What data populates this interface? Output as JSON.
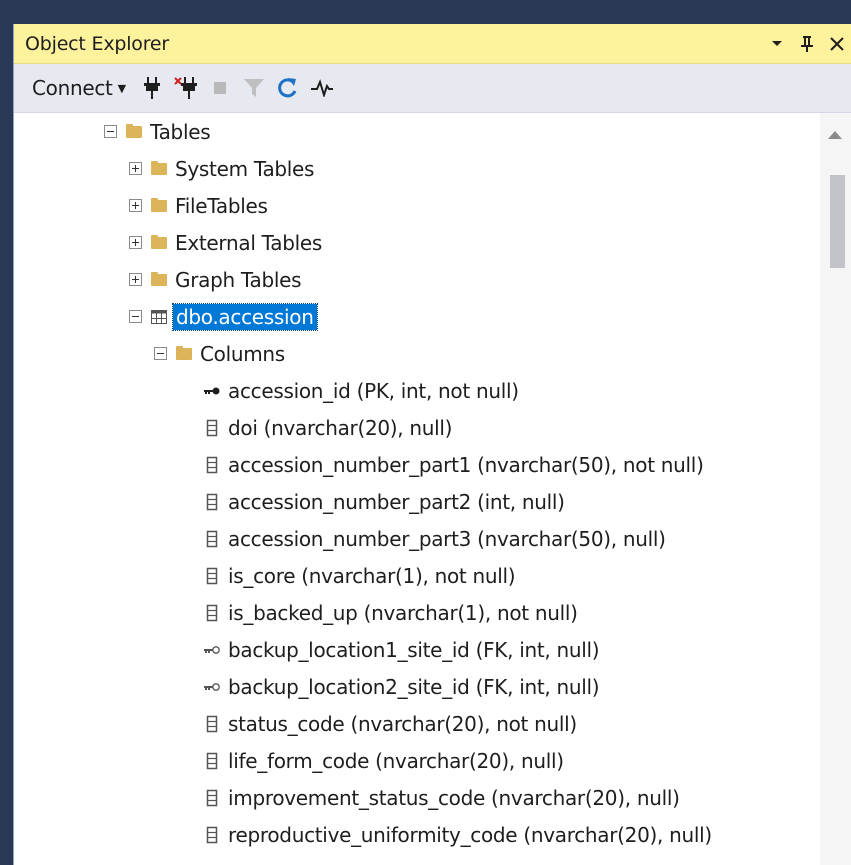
{
  "window": {
    "title": "Object Explorer",
    "controls": {
      "dropdown": "▾",
      "pin": "ᛜ",
      "close": "✕"
    }
  },
  "toolbar": {
    "connect_label": "Connect",
    "tools": [
      "connect-icon",
      "disconnect-icon",
      "stop-icon",
      "filter-icon",
      "refresh-icon",
      "activity-monitor-icon"
    ]
  },
  "tree": {
    "tables": {
      "label": "Tables"
    },
    "system_tables": {
      "label": "System Tables"
    },
    "filetables": {
      "label": "FileTables"
    },
    "external_tables": {
      "label": "External Tables"
    },
    "graph_tables": {
      "label": "Graph Tables"
    },
    "accession": {
      "label": "dbo.accession"
    },
    "columns_folder": {
      "label": "Columns"
    },
    "columns": [
      {
        "label": "accession_id (PK, int, not null)",
        "icon": "primary-key-icon"
      },
      {
        "label": "doi (nvarchar(20), null)",
        "icon": "column-icon"
      },
      {
        "label": "accession_number_part1 (nvarchar(50), not null)",
        "icon": "column-icon"
      },
      {
        "label": "accession_number_part2 (int, null)",
        "icon": "column-icon"
      },
      {
        "label": "accession_number_part3 (nvarchar(50), null)",
        "icon": "column-icon"
      },
      {
        "label": "is_core (nvarchar(1), not null)",
        "icon": "column-icon"
      },
      {
        "label": "is_backed_up (nvarchar(1), not null)",
        "icon": "column-icon"
      },
      {
        "label": "backup_location1_site_id (FK, int, null)",
        "icon": "foreign-key-icon"
      },
      {
        "label": "backup_location2_site_id (FK, int, null)",
        "icon": "foreign-key-icon"
      },
      {
        "label": "status_code (nvarchar(20), not null)",
        "icon": "column-icon"
      },
      {
        "label": "life_form_code (nvarchar(20), null)",
        "icon": "column-icon"
      },
      {
        "label": "improvement_status_code (nvarchar(20), null)",
        "icon": "column-icon"
      },
      {
        "label": "reproductive_uniformity_code (nvarchar(20), null)",
        "icon": "column-icon"
      }
    ]
  },
  "colors": {
    "titlebar": "#fff29d",
    "selection": "#0078d7",
    "folder": "#dcb45a",
    "refresh": "#1e72c4",
    "disconnect_x": "#d02020"
  }
}
